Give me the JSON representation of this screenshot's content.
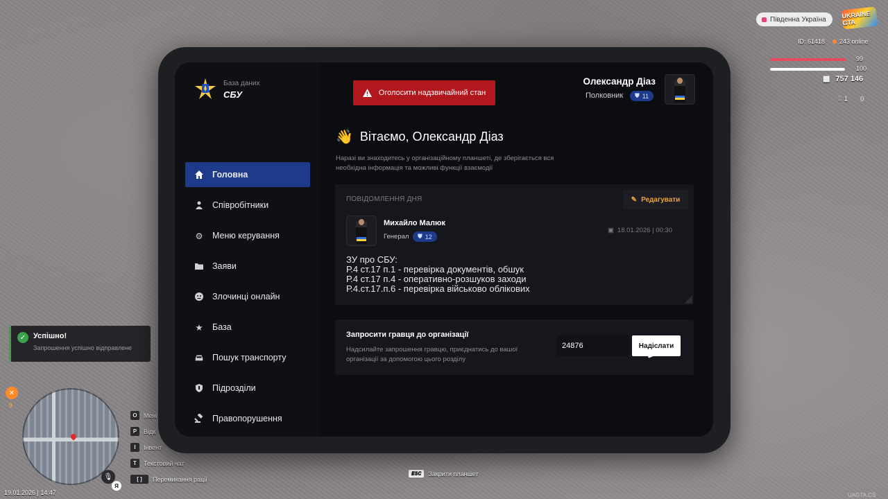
{
  "hud": {
    "server": "Південна Україна",
    "logo": "UKRAINE GTA",
    "id": "ID: 61418",
    "online": "243 online",
    "health": "99",
    "armor": "100",
    "money": "757 146",
    "ammo": "1",
    "ammo_reserve": "0"
  },
  "toast": {
    "title": "Успішно!",
    "message": "Запрошення успішно відправлене"
  },
  "hunger": "9",
  "keybinds": [
    {
      "key": "O",
      "label": "Мені"
    },
    {
      "key": "P",
      "label": "Відк"
    },
    {
      "key": "I",
      "label": "Інвент"
    },
    {
      "key": "T",
      "label": "Текстовий чат"
    },
    {
      "key": "[ ]",
      "label": "Перемикання рації"
    }
  ],
  "lang": "Я",
  "datetime": "19.01.2026 | 14:47",
  "esc_hint": {
    "key": "ESC",
    "label": "Закрити планшет"
  },
  "watermark": "UAGTA.CS",
  "tablet": {
    "logo_small": "База даних",
    "logo_big": "СБУ",
    "alert_button": "Оголосити надзвичайний стан",
    "user": {
      "name": "Олександр Діаз",
      "rank": "Полковник",
      "level": "11"
    },
    "nav": [
      {
        "label": "Головна",
        "icon": "home-icon",
        "active": true
      },
      {
        "label": "Співробітники",
        "icon": "users-icon"
      },
      {
        "label": "Меню керування",
        "icon": "gear-icon"
      },
      {
        "label": "Заяви",
        "icon": "folder-icon"
      },
      {
        "label": "Злочинці онлайн",
        "icon": "criminal-icon"
      },
      {
        "label": "База",
        "icon": "star-icon"
      },
      {
        "label": "Пошук транспорту",
        "icon": "car-icon"
      },
      {
        "label": "Підрозділи",
        "icon": "shield-icon"
      },
      {
        "label": "Правопорушення",
        "icon": "gavel-icon"
      }
    ],
    "greeting": "Вітаємо, Олександр Діаз",
    "subtext": "Наразі ви знаходитесь у організаційному планшеті, де зберігається вся необхідна інформація та можливі функції взаємодії",
    "motd": {
      "label": "ПОВІДОМЛЕННЯ ДНЯ",
      "edit": "Редагувати",
      "author": "Михайло Малюк",
      "author_rank": "Генерал",
      "author_level": "12",
      "date": "18.01.2026 | 00:30",
      "lines": [
        "ЗУ про СБУ:",
        "Р.4 ст.17 п.1 - перевірка документів, обшук",
        "Р.4 ст.17 п.4 - оперативно-розшуков заходи",
        "Р.4.ст.17.п.6 - перевірка військово облікових"
      ]
    },
    "invite": {
      "title": "Запросити гравця до організації",
      "description": "Надсилайте запрошення гравцю, приєднатись до вашої організації за допомогою цього розділу",
      "input_value": "24876",
      "button": "Надіслати"
    }
  },
  "colors": {
    "accent": "#1e3a8a",
    "alert": "#b0181e",
    "edit": "#f0a13a",
    "success": "#3ca24a"
  }
}
